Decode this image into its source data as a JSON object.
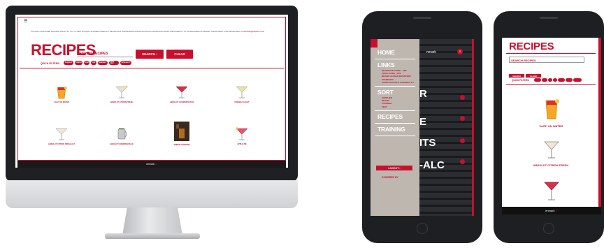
{
  "desktop": {
    "menu_icon": "hamburger-icon",
    "notice": "THIS DAILY MONITORED PROGRAM IS BUILT BY YOU, TO HELP SUSTAIN A PLANNED COMMUNITY RECIPE BOOK, PLEASE EMAIL MODIFICATIONS OR SUGGESTIONS. EMAIL GOES DIRECTLY TO THE MANAGERS OF RECIPES. PLEASE SEND YOUR RECIPE IDEAS TO",
    "notice_email": "RECIPES@ENMARK.COM",
    "title": "RECIPES",
    "search_placeholder": "SEARCH RECIPES",
    "search_button": "SEARCH",
    "clear_button": "CLEAR",
    "quick_filters_label": "QUICK FILTERS:",
    "filters": [
      "TEQUILA",
      "VODKA",
      "RUM",
      "GIN",
      "WHISKEY",
      "NON-ALC",
      "SPECIALTY"
    ],
    "recipes": [
      {
        "name": "'JAZZ' ON WATER",
        "icon": "cocktail-orange-icon"
      },
      {
        "name": "ABSOLUT CITRON FRESH",
        "icon": "martini-clear-icon"
      },
      {
        "name": "ABSOLUT COSMOPOLITAN",
        "icon": "martini-red-icon"
      },
      {
        "name": "FRENCH FLIGHT",
        "icon": "martini-yellow-icon"
      },
      {
        "name": "ABSOLUT CITRON FRESH ALT",
        "icon": "martini-clear-icon"
      },
      {
        "name": "ABSOLUT MANDRIN MULE",
        "icon": "mule-mug-icon"
      },
      {
        "name": "AMBER COMFORT",
        "icon": "photo-drink-icon"
      },
      {
        "name": "APPLE PIE",
        "icon": "cocktail-pink-icon"
      }
    ],
    "footer_brand": "enmark"
  },
  "phone_menu": {
    "items": [
      {
        "label": "HOME",
        "sub": []
      },
      {
        "label": "LINKS",
        "sub": [
          "BEVERAGE GUIDE - PDF",
          "FOOD GUIDE - PDF",
          "BRAND LEADER INVENTORY STANDARD",
          "AUDIO THOUGHT CONCEPT 2.0"
        ]
      },
      {
        "label": "SORT",
        "sub": [
          "SUPPLIER",
          "BRAND",
          "CURRENT",
          "TEST"
        ]
      },
      {
        "label": "RECIPES",
        "sub": []
      },
      {
        "label": "TRAINING",
        "sub": []
      }
    ],
    "logout_label": "LOGOUT",
    "powered_by": "POWERED BY",
    "background_words": [
      "R",
      "E",
      "ITS",
      "-ALC"
    ],
    "brand_fragment": "nmark"
  },
  "phone_recipes": {
    "title": "RECIPES",
    "search_placeholder": "SEARCH RECIPES",
    "search_button": "SEARCH",
    "clear_button": "CLEAR",
    "quick_filters_label": "QUICK FILTERS:",
    "recipes": [
      {
        "name": "'JAZZ' ON WATER",
        "icon": "cocktail-orange-icon"
      },
      {
        "name": "ABSOLUT CITRON FRESH",
        "icon": "martini-clear-icon"
      },
      {
        "name": "",
        "icon": "martini-red-icon"
      }
    ],
    "footer_brand": "enmark"
  },
  "colors": {
    "accent": "#c8102e",
    "bezel": "#1f2023",
    "menu_bg": "#bdb7b0"
  }
}
